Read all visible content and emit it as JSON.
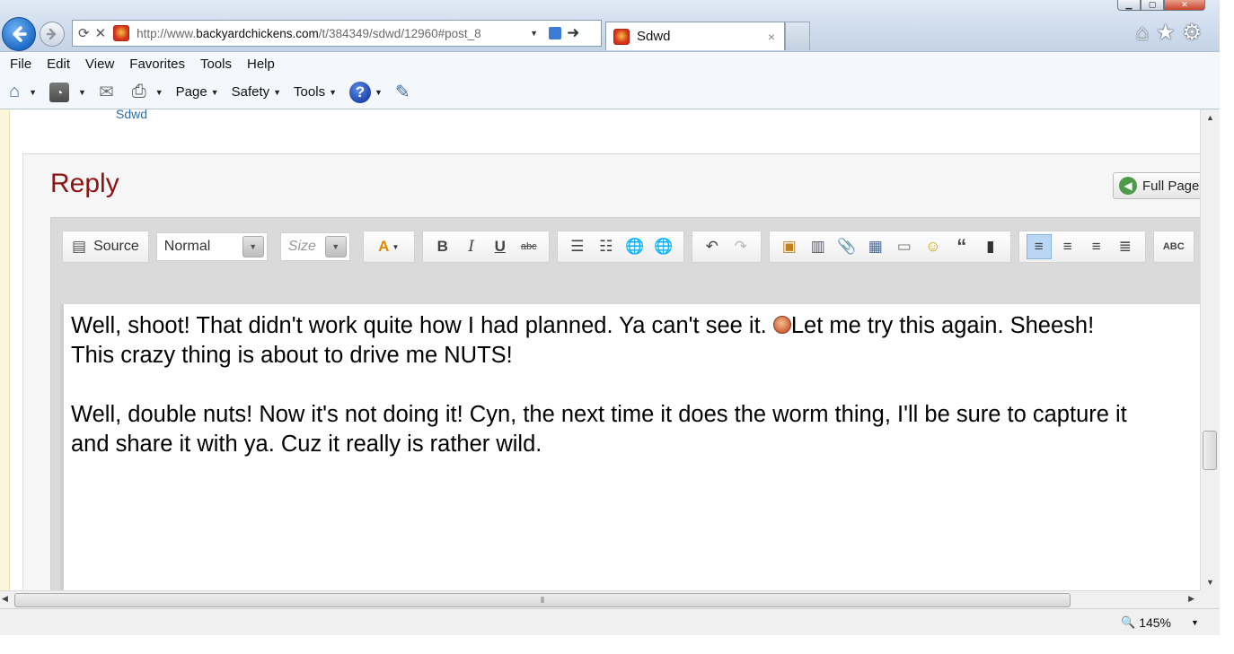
{
  "browser": {
    "url_prefix": "http://www.",
    "url_domain": "backyardchickens.com",
    "url_path": "/t/384349/sdwd/12960#post_8",
    "tab_title": "Sdwd",
    "tab_close": "×"
  },
  "menu": {
    "items": [
      "File",
      "Edit",
      "View",
      "Favorites",
      "Tools",
      "Help"
    ]
  },
  "commandbar": {
    "page_label": "Page",
    "safety_label": "Safety",
    "tools_label": "Tools",
    "help_glyph": "?"
  },
  "page": {
    "previous_author": "Sdwd",
    "reply_title": "Reply",
    "full_page_label": "Full Page"
  },
  "editor": {
    "source_label": "Source",
    "format_value": "Normal",
    "size_placeholder": "Size",
    "content": {
      "p1_line1_a": "Well, shoot! That didn't work quite how I had planned. Ya can't see it. ",
      "p1_line1_b": "Let me try this again. Sheesh!",
      "p1_line2": "This crazy thing is about to drive me NUTS!",
      "p2_line1": "Well, double nuts! Now it's not doing it! Cyn, the next time it does the worm thing, I'll be sure to capture it",
      "p2_line2": "and share it with ya. Cuz it really is rather wild."
    }
  },
  "status": {
    "zoom_level": "145%"
  },
  "colors": {
    "reply_title": "#8b1414",
    "link": "#2d6da8",
    "active_button": "#b9d6f2"
  }
}
